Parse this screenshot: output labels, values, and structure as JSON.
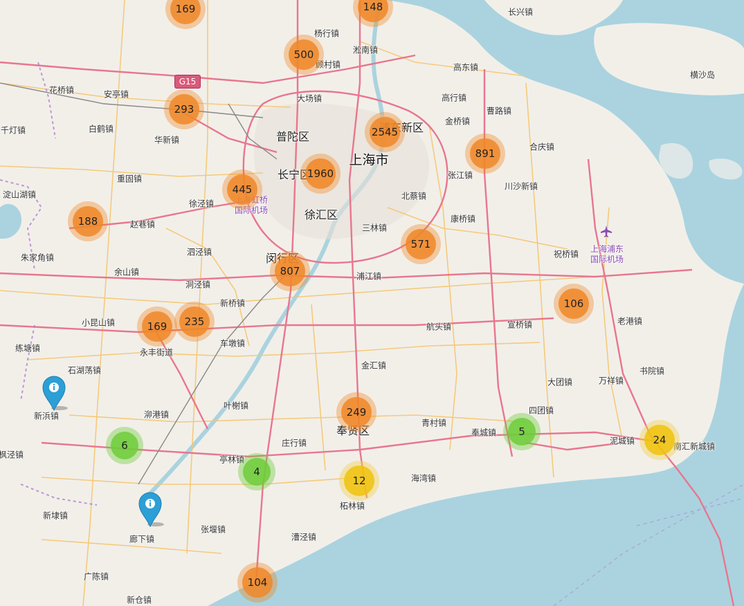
{
  "places": [
    {
      "name": "长兴镇",
      "kind": "town"
    },
    {
      "name": "横沙岛",
      "kind": "island"
    },
    {
      "name": "杨行镇",
      "kind": "town"
    },
    {
      "name": "淞南镇",
      "kind": "town"
    },
    {
      "name": "顾村镇",
      "kind": "town"
    },
    {
      "name": "高东镇",
      "kind": "town"
    },
    {
      "name": "花桥镇",
      "kind": "town"
    },
    {
      "name": "安亭镇",
      "kind": "town"
    },
    {
      "name": "大场镇",
      "kind": "town"
    },
    {
      "name": "高行镇",
      "kind": "town"
    },
    {
      "name": "白鹤镇",
      "kind": "town"
    },
    {
      "name": "曹路镇",
      "kind": "town"
    },
    {
      "name": "千灯镇",
      "kind": "town"
    },
    {
      "name": "金桥镇",
      "kind": "town"
    },
    {
      "name": "普陀区",
      "kind": "district"
    },
    {
      "name": "浦东新区",
      "kind": "district"
    },
    {
      "name": "华新镇",
      "kind": "town"
    },
    {
      "name": "合庆镇",
      "kind": "town"
    },
    {
      "name": "长宁区",
      "kind": "district"
    },
    {
      "name": "上海市",
      "kind": "city"
    },
    {
      "name": "重固镇",
      "kind": "town"
    },
    {
      "name": "张江镇",
      "kind": "town"
    },
    {
      "name": "川沙新镇",
      "kind": "town"
    },
    {
      "name": "淀山湖镇",
      "kind": "town"
    },
    {
      "name": "徐泾镇",
      "kind": "town"
    },
    {
      "name": "北蔡镇",
      "kind": "town"
    },
    {
      "name": "徐汇区",
      "kind": "district"
    },
    {
      "name": "赵巷镇",
      "kind": "town"
    },
    {
      "name": "康桥镇",
      "kind": "town"
    },
    {
      "name": "三林镇",
      "kind": "town"
    },
    {
      "name": "朱家角镇",
      "kind": "town"
    },
    {
      "name": "泗泾镇",
      "kind": "town"
    },
    {
      "name": "闵行区",
      "kind": "district"
    },
    {
      "name": "祝桥镇",
      "kind": "town"
    },
    {
      "name": "余山镇",
      "kind": "town"
    },
    {
      "name": "浦江镇",
      "kind": "town"
    },
    {
      "name": "洞泾镇",
      "kind": "town"
    },
    {
      "name": "新桥镇",
      "kind": "town"
    },
    {
      "name": "小昆山镇",
      "kind": "town"
    },
    {
      "name": "航头镇",
      "kind": "town"
    },
    {
      "name": "宣桥镇",
      "kind": "town"
    },
    {
      "name": "老港镇",
      "kind": "town"
    },
    {
      "name": "练塘镇",
      "kind": "town"
    },
    {
      "name": "车墩镇",
      "kind": "town"
    },
    {
      "name": "永丰街道",
      "kind": "town"
    },
    {
      "name": "石湖荡镇",
      "kind": "town"
    },
    {
      "name": "金汇镇",
      "kind": "town"
    },
    {
      "name": "书院镇",
      "kind": "town"
    },
    {
      "name": "大团镇",
      "kind": "town"
    },
    {
      "name": "万祥镇",
      "kind": "town"
    },
    {
      "name": "新浜镇",
      "kind": "town"
    },
    {
      "name": "叶榭镇",
      "kind": "town"
    },
    {
      "name": "四团镇",
      "kind": "town"
    },
    {
      "name": "泖港镇",
      "kind": "town"
    },
    {
      "name": "青村镇",
      "kind": "town"
    },
    {
      "name": "奉贤区",
      "kind": "district"
    },
    {
      "name": "奉城镇",
      "kind": "town"
    },
    {
      "name": "枫泾镇",
      "kind": "town"
    },
    {
      "name": "庄行镇",
      "kind": "town"
    },
    {
      "name": "泥城镇",
      "kind": "town"
    },
    {
      "name": "南汇新城镇",
      "kind": "town"
    },
    {
      "name": "亭林镇",
      "kind": "town"
    },
    {
      "name": "海湾镇",
      "kind": "town"
    },
    {
      "name": "新埭镇",
      "kind": "town"
    },
    {
      "name": "柘林镇",
      "kind": "town"
    },
    {
      "name": "张堰镇",
      "kind": "town"
    },
    {
      "name": "漕泾镇",
      "kind": "town"
    },
    {
      "name": "廊下镇",
      "kind": "town"
    },
    {
      "name": "广陈镇",
      "kind": "town"
    },
    {
      "name": "新仓镇",
      "kind": "town"
    }
  ],
  "airports": [
    {
      "name": "上海虹桥\n国际机场"
    },
    {
      "name": "上海浦东\n国际机场"
    }
  ],
  "shields": [
    {
      "label": "G15"
    }
  ],
  "clusters": [
    {
      "count": "169",
      "size": "large"
    },
    {
      "count": "148",
      "size": "large"
    },
    {
      "count": "500",
      "size": "large"
    },
    {
      "count": "293",
      "size": "large"
    },
    {
      "count": "2545",
      "size": "large"
    },
    {
      "count": "891",
      "size": "large"
    },
    {
      "count": "445",
      "size": "large"
    },
    {
      "count": "1960",
      "size": "large"
    },
    {
      "count": "188",
      "size": "large"
    },
    {
      "count": "571",
      "size": "large"
    },
    {
      "count": "807",
      "size": "large"
    },
    {
      "count": "106",
      "size": "large"
    },
    {
      "count": "169",
      "size": "large"
    },
    {
      "count": "235",
      "size": "large"
    },
    {
      "count": "249",
      "size": "large"
    },
    {
      "count": "6",
      "size": "small"
    },
    {
      "count": "5",
      "size": "small"
    },
    {
      "count": "4",
      "size": "small"
    },
    {
      "count": "12",
      "size": "medium"
    },
    {
      "count": "24",
      "size": "medium"
    },
    {
      "count": "104",
      "size": "large"
    }
  ],
  "markers": [
    {
      "type": "info",
      "icon": "info-icon"
    },
    {
      "type": "info",
      "icon": "info-icon"
    }
  ],
  "colors": {
    "land": "#f2efe9",
    "water": "#aad3df",
    "primary_road": "#e8768e",
    "secondary_road": "#f5c66f",
    "cluster_large": "#f08728",
    "cluster_medium": "#f0c20c",
    "cluster_small": "#6ecc39",
    "marker_blue": "#2c9fd6"
  }
}
